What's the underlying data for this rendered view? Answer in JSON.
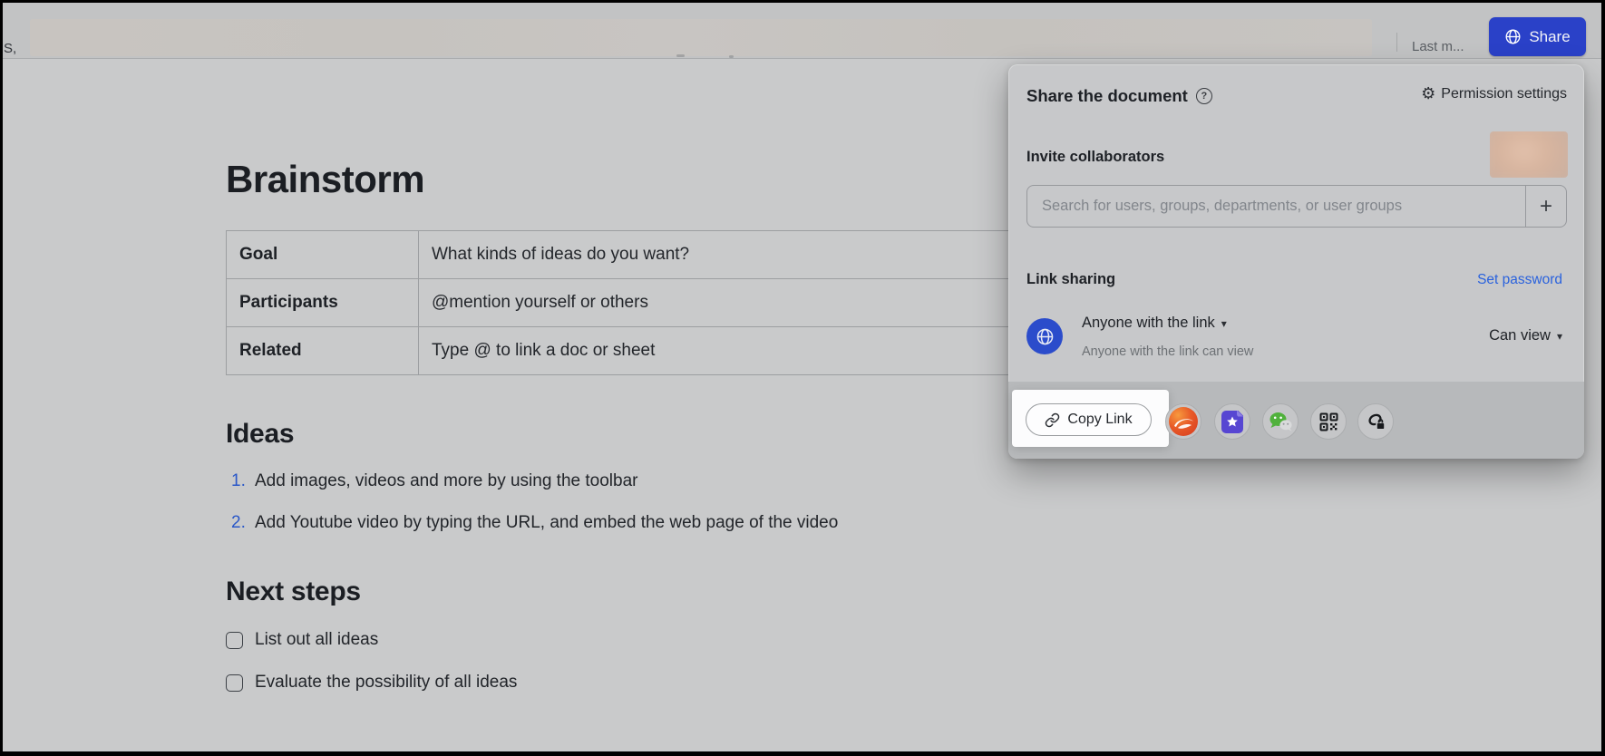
{
  "icons": {
    "chevron_down": "▾",
    "gear": "⚙",
    "plus": "+",
    "help": "?"
  },
  "topbar": {
    "truncated_left": "S,",
    "last_modified": "Last m...",
    "share_label": "Share"
  },
  "document": {
    "title": "Brainstorm",
    "table_rows": [
      {
        "label": "Goal",
        "value": "What kinds of ideas do you want?"
      },
      {
        "label": "Participants",
        "value": "@mention yourself or others"
      },
      {
        "label": "Related",
        "value": "Type @ to link a doc or sheet"
      }
    ],
    "ideas_heading": "Ideas",
    "ideas_items": [
      {
        "marker": "1.",
        "text": "Add images, videos and more by using the toolbar"
      },
      {
        "marker": "2.",
        "text": "Add Youtube video by typing the URL, and embed the web page of the video"
      }
    ],
    "next_steps_heading": "Next steps",
    "todo_items": [
      {
        "text": "List out all ideas",
        "checked": false
      },
      {
        "text": "Evaluate the possibility of all ideas",
        "checked": false
      }
    ]
  },
  "share_popover": {
    "title": "Share the document",
    "permission_settings_label": "Permission settings",
    "invite_label": "Invite collaborators",
    "search_placeholder": "Search for users, groups, departments, or user groups",
    "link_sharing_label": "Link sharing",
    "set_password_label": "Set password",
    "link_access_primary": "Anyone with the link",
    "link_access_secondary": "Anyone with the link can view",
    "permission_value": "Can view",
    "copy_link_label": "Copy Link",
    "share_channel_icons": [
      "lark-app-icon",
      "starred-doc-icon",
      "wechat-icon",
      "qr-code-icon",
      "protected-link-icon"
    ]
  },
  "colors": {
    "share_button_blue": "#2a41c8",
    "link_blue": "#2a62dd",
    "list_number_blue": "#2a58c8",
    "globe_avatar_blue": "#2b4ccb",
    "wechat_green": "#50b13c",
    "doc_purple": "#5746d2",
    "logo_red": "#e2452a",
    "spotlight_white": "#fcfcfd",
    "page_dim_gray": "#c9cacb"
  }
}
